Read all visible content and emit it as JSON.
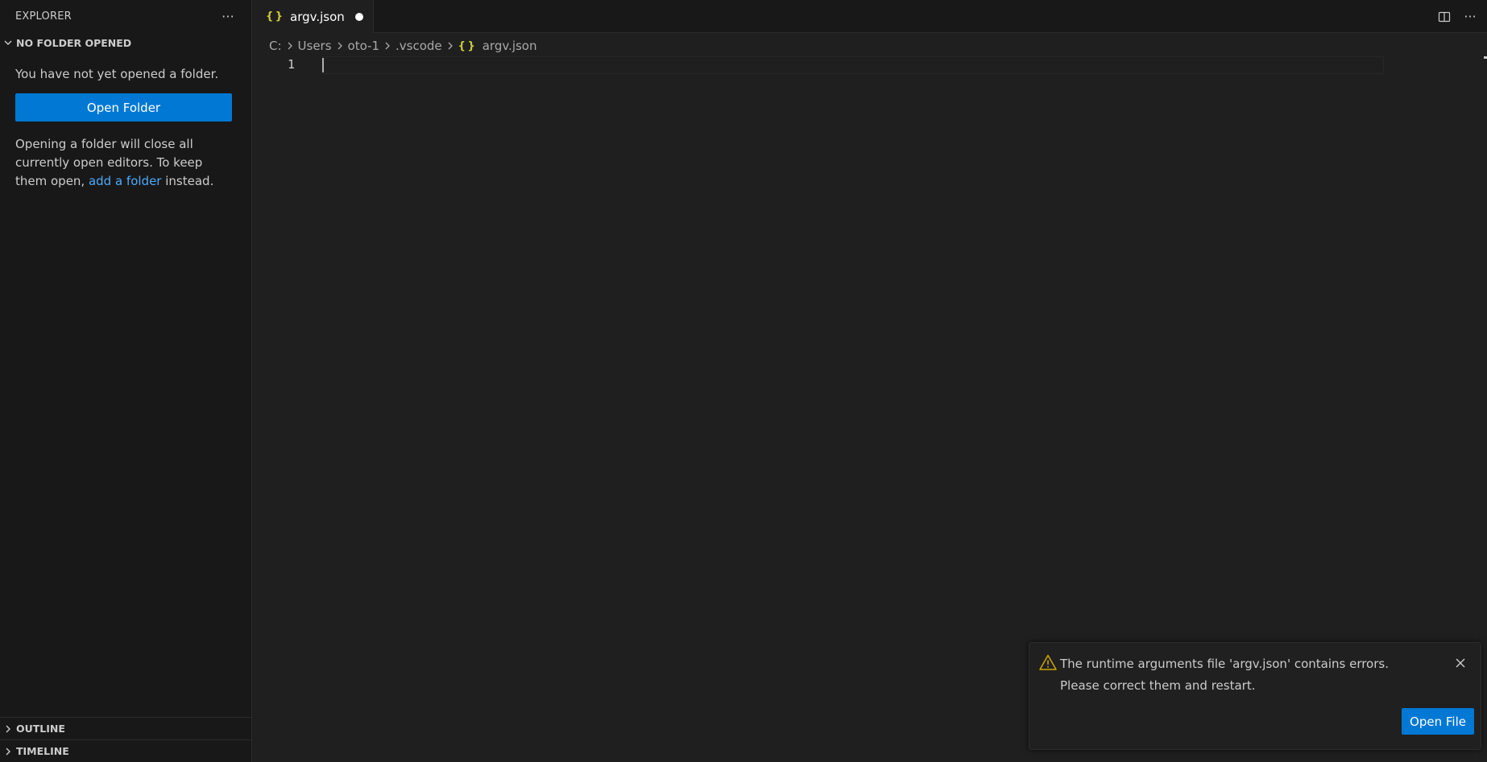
{
  "sidebar": {
    "title": "EXPLORER",
    "more_label": "···",
    "section_title": "NO FOLDER OPENED",
    "message": "You have not yet opened a folder.",
    "open_folder_label": "Open Folder",
    "hint_before": "Opening a folder will close all currently open editors. To keep them open, ",
    "hint_link": "add a folder",
    "hint_after": " instead.",
    "outline_label": "OUTLINE",
    "timeline_label": "TIMELINE"
  },
  "tabs": [
    {
      "icon": "{ }",
      "label": "argv.json",
      "dirty": true
    }
  ],
  "tab_actions": {
    "more_label": "···"
  },
  "breadcrumb": {
    "items": [
      "C:",
      "Users",
      "oto-1",
      ".vscode",
      "argv.json"
    ],
    "file_icon": "{ }"
  },
  "editor": {
    "line_number": "1",
    "content": ""
  },
  "notification": {
    "message": "The runtime arguments file 'argv.json' contains errors. Please correct them and restart.",
    "button_label": "Open File"
  },
  "colors": {
    "accent": "#0078d4",
    "link": "#4daafc",
    "warning": "#cca700",
    "json_icon": "#cbcb41"
  }
}
